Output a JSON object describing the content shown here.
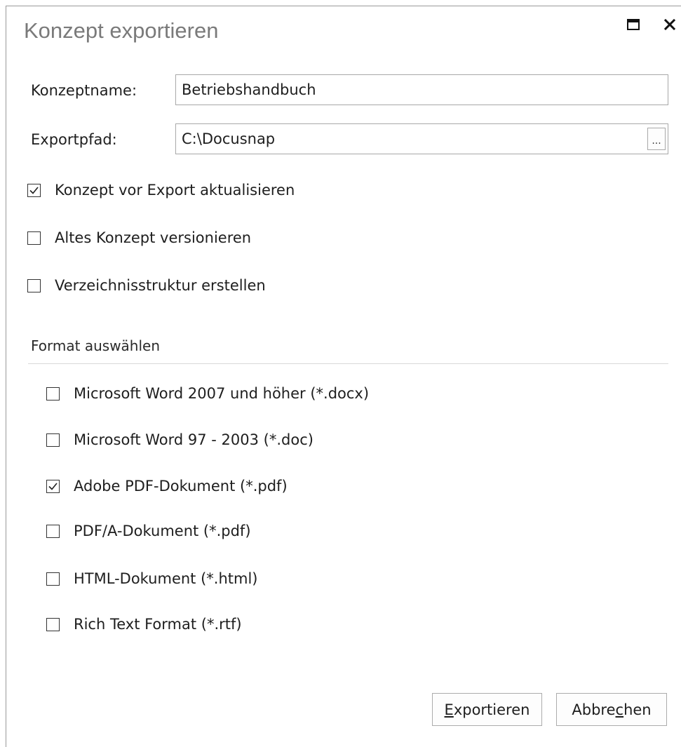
{
  "window": {
    "title": "Konzept exportieren",
    "maximize_icon": "maximize-icon",
    "close_icon": "close-icon"
  },
  "form": {
    "name_label": "Konzeptname:",
    "name_value": "Betriebshandbuch",
    "path_label": "Exportpfad:",
    "path_value": "C:\\Docusnap",
    "browse_label": "..."
  },
  "options": [
    {
      "label": "Konzept vor Export aktualisieren",
      "checked": true
    },
    {
      "label": "Altes Konzept versionieren",
      "checked": false
    },
    {
      "label": "Verzeichnisstruktur erstellen",
      "checked": false
    }
  ],
  "format_section": {
    "title": "Format auswählen",
    "formats": [
      {
        "label": "Microsoft Word 2007 und höher (*.docx)",
        "checked": false
      },
      {
        "label": "Microsoft Word 97 - 2003 (*.doc)",
        "checked": false
      },
      {
        "label": "Adobe PDF-Dokument (*.pdf)",
        "checked": true
      },
      {
        "label": "PDF/A-Dokument (*.pdf)",
        "checked": false
      },
      {
        "label": "HTML-Dokument (*.html)",
        "checked": false
      },
      {
        "label": "Rich Text Format (*.rtf)",
        "checked": false
      }
    ]
  },
  "buttons": {
    "export_mnemonic": "E",
    "export_rest": "xportieren",
    "cancel_pre": "Abbre",
    "cancel_mnemonic": "c",
    "cancel_post": "hen"
  }
}
